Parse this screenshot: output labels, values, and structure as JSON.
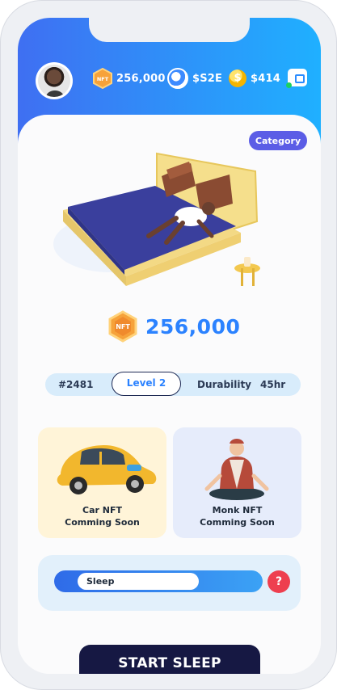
{
  "header": {
    "stats": {
      "nft_balance": "256,000",
      "se_balance": "$S2E",
      "dollar_balance": "$414"
    },
    "nft_badge_text": "NFT",
    "coin_symbol": "$"
  },
  "main": {
    "category_label": "Category",
    "balance_badge_text": "NFT",
    "balance_value": "256,000",
    "stats_bar": {
      "token_id": "#2481",
      "level": "Level 2",
      "durability_label": "Durability",
      "durability_value": "45hr"
    },
    "cards": [
      {
        "line1": "Car NFT",
        "line2": "Comming Soon"
      },
      {
        "line1": "Monk NFT",
        "line2": "Comming Soon"
      }
    ],
    "sleep_mode": "Sleep",
    "help_symbol": "?",
    "start_label": "START SLEEP"
  },
  "colors": {
    "header_gradient_start": "#3f6ff2",
    "header_gradient_end": "#1fb0ff",
    "accent_blue": "#2b82ff",
    "category_purple": "#5b5de6",
    "help_red": "#ee3f4f",
    "start_navy": "#161843"
  },
  "icons": {
    "nft": "nft-badge-icon",
    "s2e_coin": "s2e-coin-icon",
    "dollar_coin": "dollar-coin-icon",
    "wallet": "wallet-icon",
    "help": "question-icon"
  }
}
